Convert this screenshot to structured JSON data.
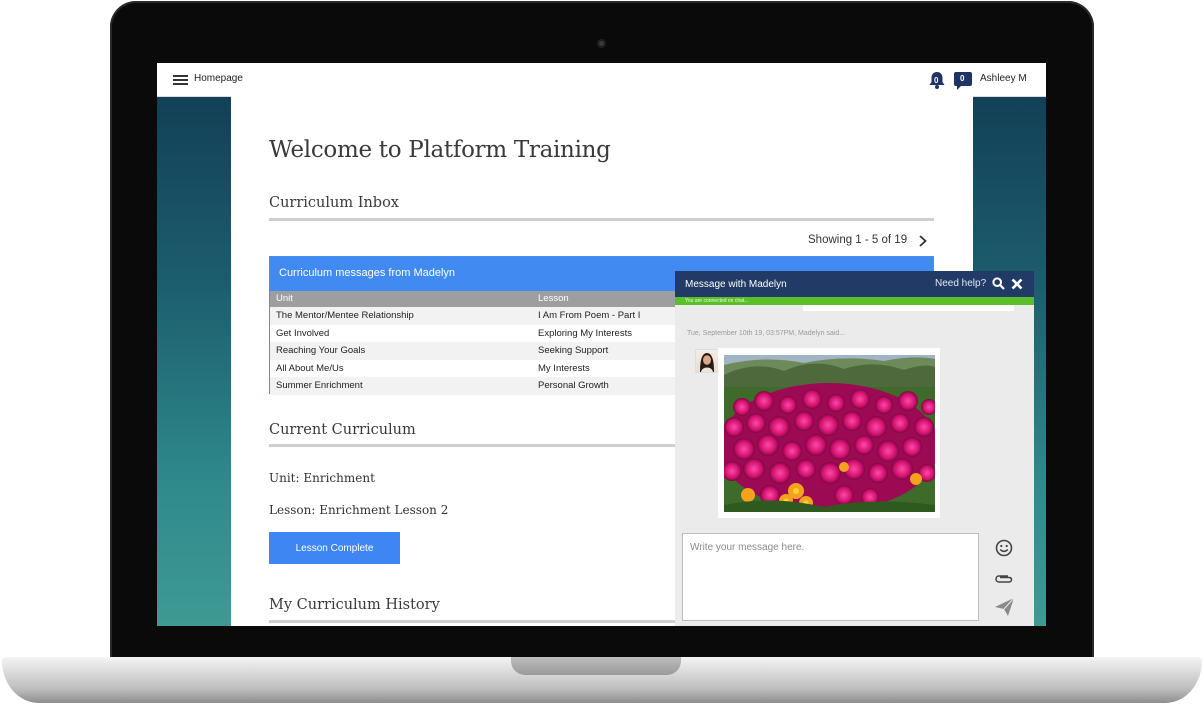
{
  "topbar": {
    "home_label": "Homepage",
    "notifications_count": "0",
    "messages_count": "0",
    "user_name": "Ashleey M"
  },
  "main": {
    "page_title": "Welcome to Platform Training",
    "inbox": {
      "title": "Curriculum Inbox",
      "pagination": "Showing 1 - 5 of 19",
      "header": "Curriculum messages from Madelyn",
      "columns": [
        "Unit",
        "Lesson"
      ],
      "rows": [
        {
          "unit": "The Mentor/Mentee Relationship",
          "lesson": "I Am From Poem - Part I"
        },
        {
          "unit": "Get Involved",
          "lesson": "Exploring My Interests"
        },
        {
          "unit": "Reaching Your Goals",
          "lesson": "Seeking Support"
        },
        {
          "unit": "All About Me/Us",
          "lesson": "My Interests"
        },
        {
          "unit": "Summer Enrichment",
          "lesson": "Personal Growth"
        }
      ]
    },
    "current": {
      "title": "Current Curriculum",
      "unit": "Unit: Enrichment",
      "lesson": "Lesson: Enrichment Lesson 2",
      "complete_button": "Lesson Complete"
    },
    "history": {
      "title": "My Curriculum History"
    }
  },
  "chat": {
    "title": "Message with Madelyn",
    "help_label": "Need help?",
    "status": "You are connected on chat...",
    "message_meta": "Tue, September 10th 19, 03:57PM, Madelyn said...",
    "input_placeholder": "Write your message here."
  },
  "colors": {
    "accent": "#418af2",
    "chat_header": "#223a66",
    "chat_status": "#5bbf2a",
    "background_gradient_top": "#113b52",
    "background_gradient_bottom": "#3e9a93"
  },
  "icons": [
    "hamburger-icon",
    "bell-icon",
    "chat-bubble-icon",
    "chevron-right-icon",
    "search-icon",
    "close-icon",
    "emoji-icon",
    "paperclip-icon",
    "send-icon"
  ]
}
